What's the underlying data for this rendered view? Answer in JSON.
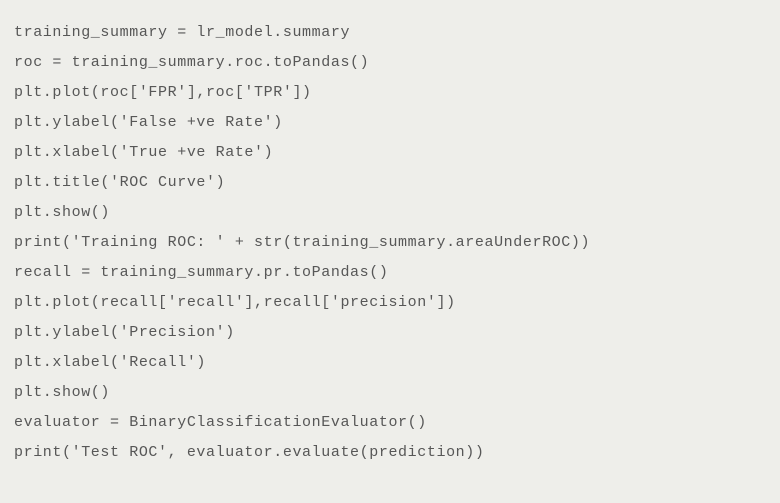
{
  "code": {
    "lines": [
      "training_summary = lr_model.summary",
      "roc = training_summary.roc.toPandas()",
      "plt.plot(roc['FPR'],roc['TPR'])",
      "plt.ylabel('False +ve Rate')",
      "plt.xlabel('True +ve Rate')",
      "plt.title('ROC Curve')",
      "plt.show()",
      "print('Training ROC: ' + str(training_summary.areaUnderROC))",
      "recall = training_summary.pr.toPandas()",
      "plt.plot(recall['recall'],recall['precision'])",
      "plt.ylabel('Precision')",
      "plt.xlabel('Recall')",
      "plt.show()",
      "evaluator = BinaryClassificationEvaluator()",
      "print('Test ROC', evaluator.evaluate(prediction))"
    ]
  }
}
